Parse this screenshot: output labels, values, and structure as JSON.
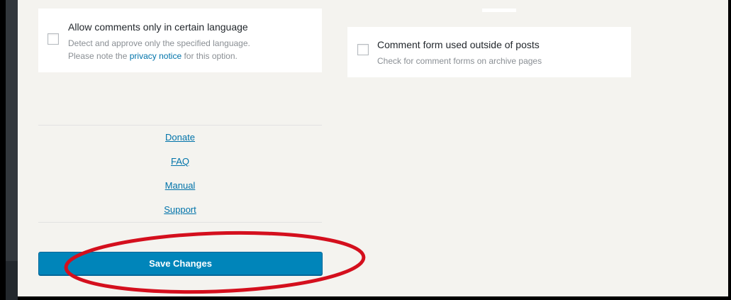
{
  "options": {
    "language": {
      "title": "Allow comments only in certain language",
      "desc_line1": "Detect and approve only the specified language.",
      "desc_prefix": "Please note the",
      "link": "privacy notice",
      "desc_suffix": "for this option."
    },
    "outside_posts": {
      "title": "Comment form used outside of posts",
      "desc": "Check for comment forms on archive pages"
    }
  },
  "links": {
    "donate": "Donate",
    "faq": "FAQ",
    "manual": "Manual",
    "support": "Support"
  },
  "save_button": "Save Changes",
  "colors": {
    "accent": "#0085ba",
    "link": "#0073aa",
    "annotation": "#d40f1d",
    "background": "#f4f3ef"
  }
}
